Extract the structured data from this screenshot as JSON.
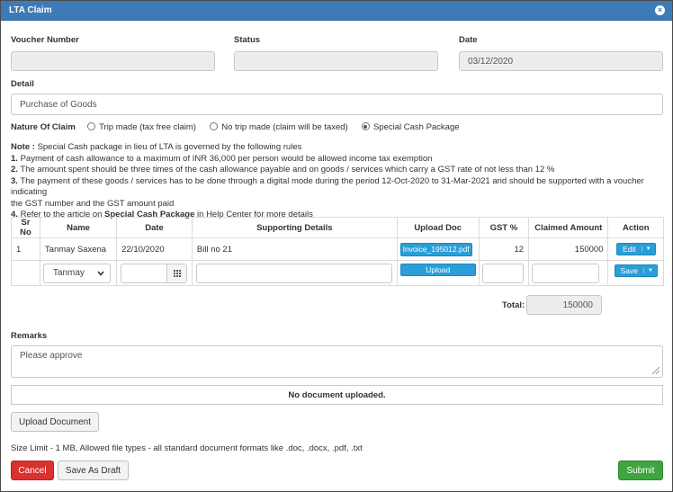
{
  "dialog": {
    "title": "LTA Claim"
  },
  "form": {
    "voucher_label": "Voucher Number",
    "voucher_value": "",
    "status_label": "Status",
    "status_value": "",
    "date_label": "Date",
    "date_value": "03/12/2020",
    "detail_label": "Detail",
    "detail_value": "Purchase of Goods",
    "nature_label": "Nature Of Claim",
    "nature_options": [
      {
        "label": "Trip made (tax free claim)",
        "selected": false
      },
      {
        "label": "No trip made (claim will be taxed)",
        "selected": false
      },
      {
        "label": "Special Cash Package",
        "selected": true
      }
    ]
  },
  "notes": {
    "note_label": "Note :",
    "note_text": "Special Cash package in lieu of LTA is governed by the following rules",
    "rule1_num": "1.",
    "rule1": "Payment of cash allowance to a maximum of INR 36,000 per person would be allowed income tax exemption",
    "rule2_num": "2.",
    "rule2": "The amount spent should be three times of the cash allowance payable and on goods / services which carry a GST rate of not less than 12 %",
    "rule3_num": "3.",
    "rule3a": "The payment of these goods / services has to be done through a digital mode during the period 12-Oct-2020 to 31-Mar-2021 and should be supported with a voucher indicating",
    "rule3b": "the GST number and the GST amount paid",
    "rule4_num": "4.",
    "rule4_pre": "Refer to the article on",
    "rule4_bold": "Special Cash Package",
    "rule4_post": "in Help Center for more details"
  },
  "table": {
    "headers": [
      "Sr No",
      "Name",
      "Date",
      "Supporting Details",
      "Upload Doc",
      "GST %",
      "Claimed Amount",
      "Action"
    ],
    "rows": [
      {
        "sr": "1",
        "name": "Tanmay Saxena",
        "date": "22/10/2020",
        "details": "Bill no 21",
        "upload": "Invoice_195012.pdf",
        "gst": "12",
        "amount": "150000",
        "action": "Edit"
      }
    ],
    "new_row": {
      "name_selected": "Tanmay",
      "date_value": "",
      "details_value": "",
      "upload_label": "Upload",
      "gst_value": "",
      "amount_value": "",
      "action": "Save"
    },
    "total_label": "Total:",
    "total_value": "150000"
  },
  "remarks": {
    "label": "Remarks",
    "value": "Please approve",
    "no_doc": "No document uploaded.",
    "upload_button": "Upload Document",
    "size_limit": "Size Limit - 1 MB, Allowed file types - all standard document formats like .doc, .docx, .pdf, .txt"
  },
  "footer": {
    "cancel": "Cancel",
    "draft": "Save As Draft",
    "submit": "Submit"
  },
  "colors": {
    "titlebar": "#3d7ab7",
    "primary_button": "#2a9ed8",
    "cancel": "#d9322e",
    "submit": "#3fa53f"
  }
}
